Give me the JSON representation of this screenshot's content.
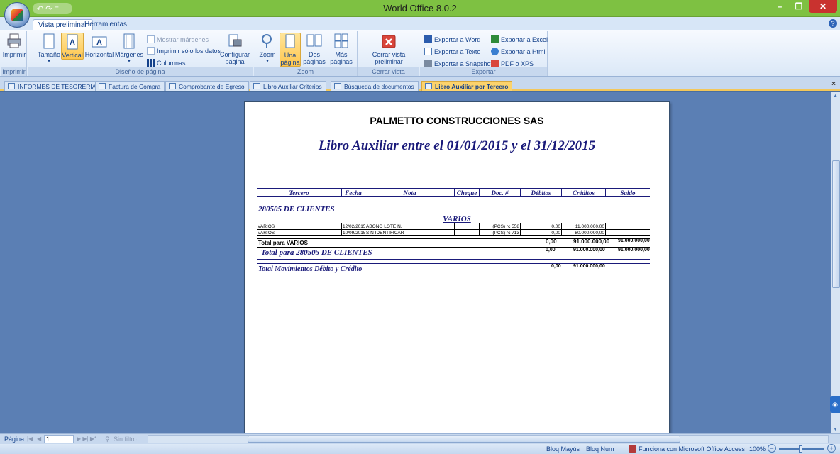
{
  "window": {
    "title": "World Office 8.0.2",
    "minimize": "–",
    "restore": "❐",
    "close": "✕"
  },
  "qat": {
    "undo": "↶",
    "redo": "↷",
    "more": "="
  },
  "ribbon_tabs": [
    "Vista preliminar",
    "Herramientas"
  ],
  "ribbon": {
    "imprimir": {
      "button": "Imprimir",
      "group": "Imprimir"
    },
    "diseno": {
      "group": "Diseño de página",
      "tamano": "Tamaño",
      "vertical": "Vertical",
      "horizontal": "Horizontal",
      "margenes": "Márgenes",
      "mostrar_margenes": "Mostrar márgenes",
      "imprimir_solo_datos": "Imprimir sólo los datos",
      "columnas": "Columnas",
      "configurar": "Configurar",
      "pagina": "página"
    },
    "zoom": {
      "group": "Zoom",
      "zoom": "Zoom",
      "una": "Una",
      "una2": "página",
      "dos": "Dos",
      "dos2": "páginas",
      "mas": "Más",
      "mas2": "páginas"
    },
    "cerrar": {
      "group": "Cerrar vista preliminar",
      "button1": "Cerrar vista",
      "button2": "preliminar"
    },
    "exportar": {
      "group": "Exportar",
      "word": "Exportar a Word",
      "excel": "Exportar a Excel",
      "texto": "Exportar a Texto",
      "html": "Exportar a Html",
      "snapshot": "Exportar a Snapshot",
      "pdf": "PDF o XPS"
    }
  },
  "doc_tabs": [
    "INFORMES DE TESORERIA",
    "Factura de Compra",
    "Comprobante de Egreso",
    "Libro Auxiliar Criterios",
    "Búsqueda de documentos",
    "Libro Auxiliar por Tercero"
  ],
  "report": {
    "company": "PALMETTO CONSTRUCCIONES SAS",
    "title": "Libro Auxiliar entre el 01/01/2015 y el 31/12/2015",
    "columns": [
      "Tercero",
      "Fecha",
      "Nota",
      "Cheque",
      "Doc. #",
      "Débitos",
      "Créditos",
      "Saldo"
    ],
    "account": "280505 DE CLIENTES",
    "group": "VARIOS",
    "rows": [
      {
        "tercero": "VARIOS",
        "fecha": "12/02/2015",
        "nota": "ABONO LOTE N.",
        "cheque": "",
        "doc": "(PCS) rc 558",
        "debitos": "0,00",
        "creditos": "11.000.000,00",
        "saldo": ""
      },
      {
        "tercero": "VARIOS",
        "fecha": "10/09/2015",
        "nota": "SIN IDENTIFICAR",
        "cheque": "",
        "doc": "(PCS) rc 713",
        "debitos": "0,00",
        "creditos": "80.000.000,00",
        "saldo": ""
      }
    ],
    "total_group": {
      "label": "Total para VARIOS",
      "debitos": "0,00",
      "creditos": "91.000.000,00",
      "saldo": "91.000.000,00"
    },
    "total_account": {
      "label": "Total para  280505 DE CLIENTES",
      "debitos": "0,00",
      "creditos": "91.000.000,00",
      "saldo": "91.000.000,00"
    },
    "total_mov": {
      "label": "Total Movimientos Débito y Crédito",
      "debitos": "0,00",
      "creditos": "91.000.000,00"
    }
  },
  "nav": {
    "label": "Página:",
    "page": "1",
    "filter": "Sin filtro"
  },
  "status": {
    "caps": "Bloq Mayús",
    "num": "Bloq Num",
    "access": "Funciona con Microsoft Office Access",
    "zoom": "100%"
  }
}
